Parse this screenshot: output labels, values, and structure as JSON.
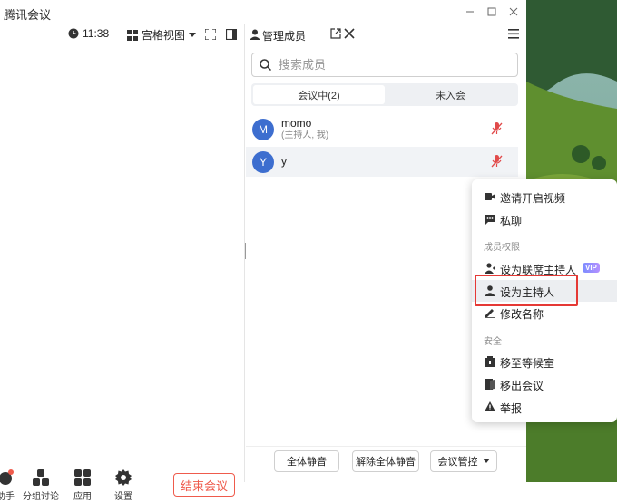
{
  "window": {
    "title": "腾讯会议"
  },
  "toolbar": {
    "time": "11:38",
    "view_label": "宫格视图"
  },
  "bottom_toolbar": {
    "items": [
      {
        "label": "助手"
      },
      {
        "label": "分组讨论"
      },
      {
        "label": "应用"
      },
      {
        "label": "设置"
      }
    ],
    "end_meeting": "结束会议"
  },
  "members_panel": {
    "title": "管理成员",
    "search_placeholder": "搜索成员",
    "tabs": [
      {
        "label": "会议中(2)",
        "active": true
      },
      {
        "label": "未入会",
        "active": false
      }
    ],
    "members": [
      {
        "initial": "M",
        "name": "momo",
        "sub": "(主持人, 我)"
      },
      {
        "initial": "Y",
        "name": "y",
        "sub": ""
      }
    ],
    "buttons": {
      "mute_all": "全体静音",
      "unmute_all": "解除全体静音",
      "meeting_control": "会议管控"
    }
  },
  "context_menu": {
    "items_top": [
      {
        "label": "邀请开启视频",
        "icon": "video-camera-icon"
      },
      {
        "label": "私聊",
        "icon": "chat-bubble-icon"
      }
    ],
    "section_permissions": "成员权限",
    "items_permissions": [
      {
        "label": "设为联席主持人",
        "icon": "co-host-icon",
        "badge": "VIP"
      },
      {
        "label": "设为主持人",
        "icon": "host-person-icon"
      },
      {
        "label": "修改名称",
        "icon": "pencil-icon"
      }
    ],
    "section_security": "安全",
    "items_security": [
      {
        "label": "移至等候室",
        "icon": "waiting-room-icon"
      },
      {
        "label": "移出会议",
        "icon": "remove-door-icon"
      },
      {
        "label": "举报",
        "icon": "warning-icon"
      }
    ]
  },
  "colors": {
    "accent_blue": "#3d6ecf",
    "end_meeting_red": "#ef5b4c",
    "highlight_red": "#e53935",
    "mic_muted": "#e14b4b"
  }
}
